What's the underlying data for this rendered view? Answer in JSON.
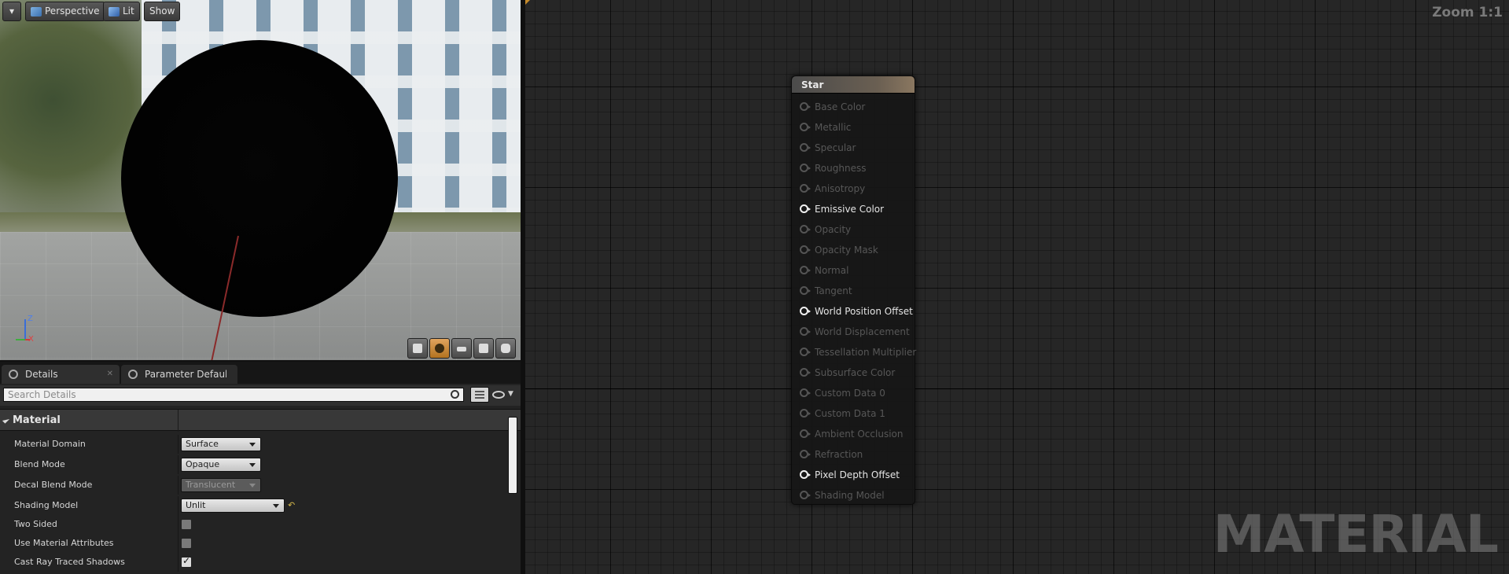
{
  "viewport": {
    "menu_label": "▾",
    "perspective_label": "Perspective",
    "lit_label": "Lit",
    "show_label": "Show",
    "axis_z": "Z",
    "axis_x": "X"
  },
  "details": {
    "tabs": [
      {
        "label": "Details"
      },
      {
        "label": "Parameter Defaults"
      }
    ],
    "search_placeholder": "Search Details",
    "category": "Material",
    "rows": [
      {
        "name": "Material Domain",
        "value": "Surface"
      },
      {
        "name": "Blend Mode",
        "value": "Opaque"
      },
      {
        "name": "Decal Blend Mode",
        "value": "Translucent"
      },
      {
        "name": "Shading Model",
        "value": "Unlit"
      },
      {
        "name": "Two Sided",
        "checked": false
      },
      {
        "name": "Use Material Attributes",
        "checked": false
      },
      {
        "name": "Cast Ray Traced Shadows",
        "checked": true
      }
    ],
    "reset_glyph": "↶"
  },
  "graph": {
    "zoom_label": "Zoom 1:1",
    "watermark": "MATERIAL",
    "node": {
      "title": "Star",
      "pins": [
        {
          "label": "Base Color",
          "active": false
        },
        {
          "label": "Metallic",
          "active": false
        },
        {
          "label": "Specular",
          "active": false
        },
        {
          "label": "Roughness",
          "active": false
        },
        {
          "label": "Anisotropy",
          "active": false
        },
        {
          "label": "Emissive Color",
          "active": true
        },
        {
          "label": "Opacity",
          "active": false
        },
        {
          "label": "Opacity Mask",
          "active": false
        },
        {
          "label": "Normal",
          "active": false
        },
        {
          "label": "Tangent",
          "active": false
        },
        {
          "label": "World Position Offset",
          "active": true
        },
        {
          "label": "World Displacement",
          "active": false
        },
        {
          "label": "Tessellation Multiplier",
          "active": false
        },
        {
          "label": "Subsurface Color",
          "active": false
        },
        {
          "label": "Custom Data 0",
          "active": false
        },
        {
          "label": "Custom Data 1",
          "active": false
        },
        {
          "label": "Ambient Occlusion",
          "active": false
        },
        {
          "label": "Refraction",
          "active": false
        },
        {
          "label": "Pixel Depth Offset",
          "active": true
        },
        {
          "label": "Shading Model",
          "active": false
        }
      ]
    }
  },
  "colors": {
    "accent": "#c58a2a",
    "pin_active": "#f2f2f2",
    "pin_inactive": "#575757"
  }
}
